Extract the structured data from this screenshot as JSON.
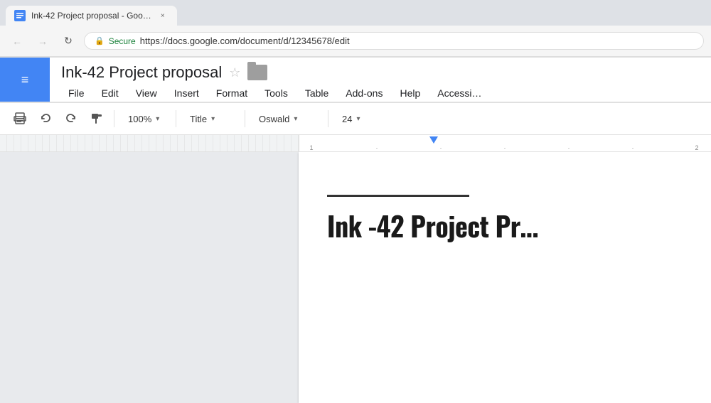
{
  "browser": {
    "tab": {
      "title": "Ink-42 Project proposal - Goo…",
      "close_label": "×"
    },
    "address": {
      "back_icon": "←",
      "forward_icon": "→",
      "refresh_icon": "↻",
      "secure_label": "Secure",
      "url": "https://docs.google.com/document/d/12345678/edit"
    }
  },
  "docs": {
    "title": "Ink-42 Project proposal",
    "star_icon": "☆",
    "menu": {
      "items": [
        "File",
        "Edit",
        "View",
        "Insert",
        "Format",
        "Tools",
        "Table",
        "Add-ons",
        "Help",
        "Accessi…"
      ]
    },
    "toolbar": {
      "zoom": "100%",
      "style": "Title",
      "font": "Oswald",
      "size": "24"
    },
    "page": {
      "title_text": "Ink -42 Project Pr…"
    }
  }
}
